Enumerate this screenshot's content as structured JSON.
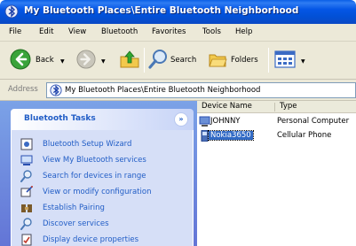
{
  "window": {
    "title": "My Bluetooth Places\\Entire Bluetooth Neighborhood",
    "app_icon": "bluetooth-places-icon"
  },
  "menubar": {
    "items": [
      "File",
      "Edit",
      "View",
      "Bluetooth",
      "Favorites",
      "Tools",
      "Help"
    ]
  },
  "toolbar": {
    "back_label": "Back",
    "search_label": "Search",
    "folders_label": "Folders",
    "icons": [
      "back-arrow-icon",
      "forward-arrow-icon",
      "up-folder-icon",
      "search-icon",
      "folders-icon",
      "views-icon"
    ]
  },
  "address": {
    "label": "Address",
    "value": "My Bluetooth Places\\Entire Bluetooth Neighborhood"
  },
  "tasks": {
    "header": "Bluetooth Tasks",
    "collapse_glyph": "»",
    "items": [
      {
        "label": "Bluetooth Setup Wizard",
        "icon": "wizard-icon"
      },
      {
        "label": "View My Bluetooth services",
        "icon": "services-icon"
      },
      {
        "label": "Search for devices in range",
        "icon": "search-devices-icon"
      },
      {
        "label": "View or modify configuration",
        "icon": "configuration-icon"
      },
      {
        "label": "Establish Pairing",
        "icon": "pairing-icon"
      },
      {
        "label": "Discover services",
        "icon": "discover-icon"
      },
      {
        "label": "Display device properties",
        "icon": "properties-icon"
      }
    ]
  },
  "list": {
    "columns": [
      "Device Name",
      "Type"
    ],
    "rows": [
      {
        "name": "JOHNNY",
        "type": "Personal Computer",
        "icon": "computer-icon",
        "selected": false
      },
      {
        "name": "Nokia3650",
        "type": "Cellular Phone",
        "icon": "phone-icon",
        "selected": true
      }
    ]
  },
  "colors": {
    "title_bar": "#0456e5",
    "chrome": "#ece9d8",
    "task_pane": "#6f8ee0",
    "task_link": "#215dc6",
    "selection": "#316ac5"
  }
}
